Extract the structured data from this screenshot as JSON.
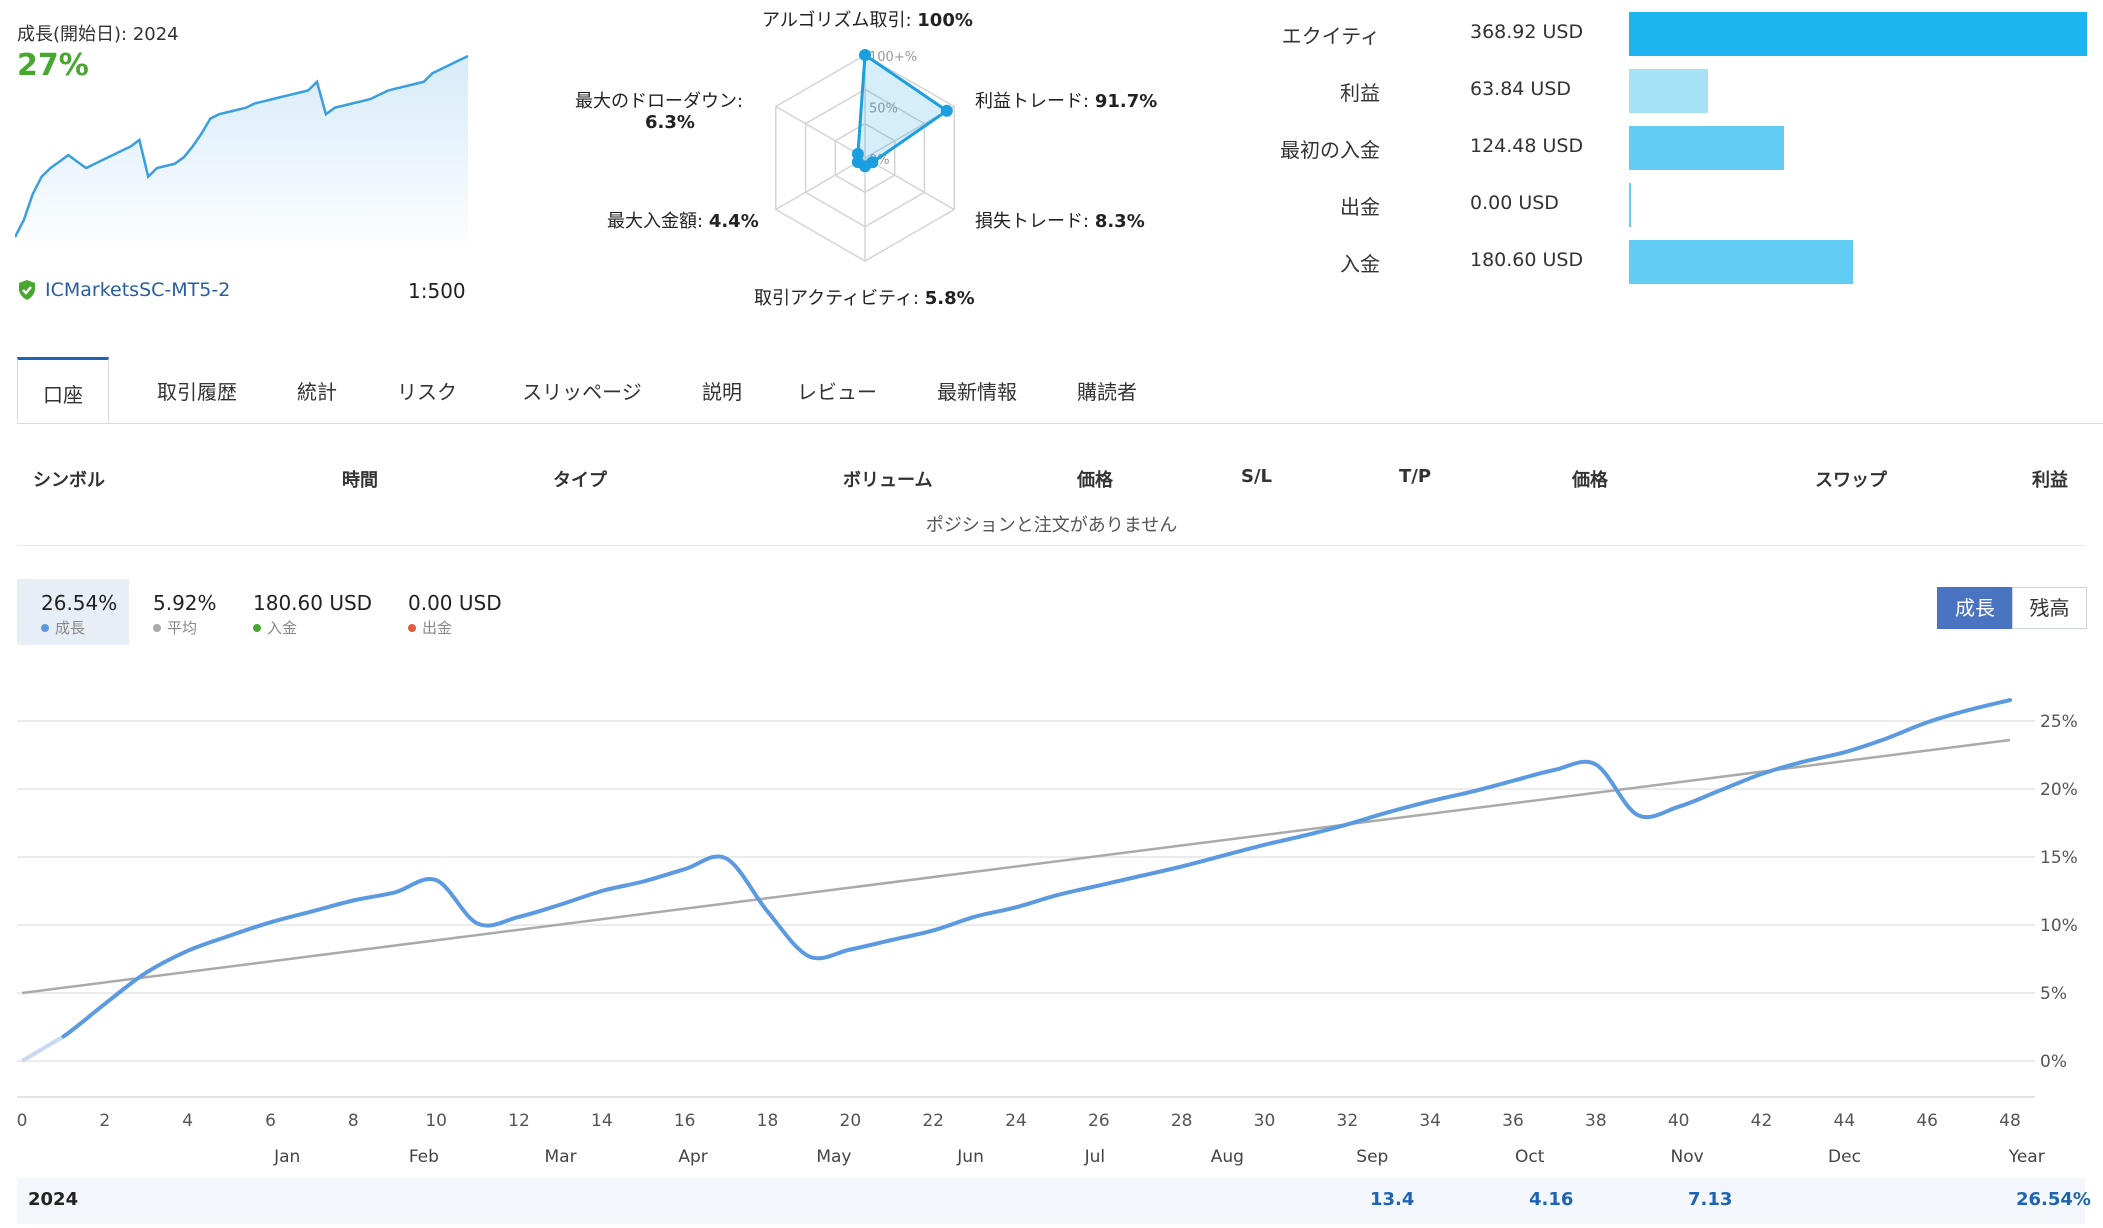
{
  "account": {
    "growth_label": "成長(開始日): 2024",
    "growth_value": "27%",
    "broker": "ICMarketsSC-MT5-2",
    "leverage": "1:500"
  },
  "radar": {
    "labels": [
      {
        "name": "アルゴリズム取引:",
        "value": "100%"
      },
      {
        "name": "利益トレード:",
        "value": "91.7%"
      },
      {
        "name": "損失トレード:",
        "value": "8.3%"
      },
      {
        "name": "取引アクティビティ:",
        "value": "5.8%"
      },
      {
        "name": "最大入金額:",
        "value": "4.4%"
      },
      {
        "name": "最大のドローダウン:",
        "value": "6.3%"
      }
    ],
    "values": [
      100,
      91.7,
      8.3,
      5.8,
      4.4,
      6.3
    ],
    "scale_labels": [
      "100+%",
      "50%",
      "0%"
    ],
    "accent_color": "#1aa0e0"
  },
  "stats": [
    {
      "label": "エクイティ",
      "value": "368.92 USD",
      "amount": 368.92,
      "color": "#1eb4ef"
    },
    {
      "label": "利益",
      "value": "63.84 USD",
      "amount": 63.84,
      "color": "#a7e1f6"
    },
    {
      "label": "最初の入金",
      "value": "124.48 USD",
      "amount": 124.48,
      "color": "#62cdf4"
    },
    {
      "label": "出金",
      "value": "0.00 USD",
      "amount": 0.0,
      "color": "#62cdf4"
    },
    {
      "label": "入金",
      "value": "180.60 USD",
      "amount": 180.6,
      "color": "#62cdf4"
    }
  ],
  "tabs": [
    "口座",
    "取引履歴",
    "統計",
    "リスク",
    "スリッページ",
    "説明",
    "レビュー",
    "最新情報",
    "購読者"
  ],
  "table": {
    "headers": [
      "シンボル",
      "時間",
      "タイプ",
      "ボリューム",
      "価格",
      "S/L",
      "T/P",
      "価格",
      "スワップ",
      "利益"
    ],
    "empty_message": "ポジションと注文がありません"
  },
  "summary": [
    {
      "value": "26.54%",
      "label": "成長",
      "color": "#5b9ae0"
    },
    {
      "value": "5.92%",
      "label": "平均",
      "color": "#aaaaaa"
    },
    {
      "value": "180.60 USD",
      "label": "入金",
      "color": "#46a82f"
    },
    {
      "value": "0.00 USD",
      "label": "出金",
      "color": "#e05a3a"
    }
  ],
  "toggle": {
    "growth": "成長",
    "balance": "残高"
  },
  "mini_chart": {
    "values": [
      0,
      4,
      10,
      14,
      16,
      17.5,
      19,
      17.5,
      16,
      17,
      18,
      19,
      20,
      21,
      22.5,
      14,
      16,
      16.5,
      17,
      18.5,
      21,
      24,
      27.5,
      28.5,
      29,
      29.5,
      30,
      31,
      31.5,
      32,
      32.5,
      33,
      33.5,
      34,
      36,
      28.5,
      30,
      30.5,
      31,
      31.5,
      32,
      33,
      34,
      34.5,
      35,
      35.5,
      36,
      38,
      39,
      40,
      41,
      42
    ]
  },
  "chart_data": {
    "type": "line",
    "x": [
      0,
      1,
      2,
      3,
      4,
      5,
      6,
      7,
      8,
      9,
      10,
      11,
      12,
      13,
      14,
      15,
      16,
      17,
      18,
      19,
      20,
      21,
      22,
      23,
      24,
      25,
      26,
      27,
      28,
      29,
      30,
      31,
      32,
      33,
      34,
      35,
      36,
      37,
      38,
      39,
      40,
      41,
      42,
      43,
      44,
      45,
      46,
      47,
      48
    ],
    "series": [
      {
        "name": "成長",
        "color": "#5b9ae0",
        "values": [
          0,
          1.8,
          4.2,
          6.5,
          8.1,
          9.2,
          10.2,
          11.0,
          11.8,
          12.4,
          13.3,
          10.1,
          10.6,
          11.5,
          12.5,
          13.2,
          14.1,
          14.9,
          11.0,
          7.7,
          8.2,
          8.9,
          9.6,
          10.6,
          11.3,
          12.2,
          12.9,
          13.6,
          14.3,
          15.1,
          15.9,
          16.6,
          17.4,
          18.3,
          19.1,
          19.8,
          20.6,
          21.4,
          21.8,
          18.1,
          18.7,
          19.9,
          21.1,
          22.0,
          22.7,
          23.7,
          24.9,
          25.8,
          26.54
        ]
      },
      {
        "name": "平均",
        "color": "#aaaaaa",
        "trend": true,
        "values_endpoints": [
          5.0,
          23.6
        ]
      }
    ],
    "xlim": [
      0,
      48
    ],
    "ylim": [
      -2,
      28
    ],
    "yticks": [
      0,
      5,
      10,
      15,
      20,
      25
    ],
    "ytick_labels": [
      "0%",
      "5%",
      "10%",
      "15%",
      "20%",
      "25%"
    ],
    "xticks": [
      0,
      2,
      4,
      6,
      8,
      10,
      12,
      14,
      16,
      18,
      20,
      22,
      24,
      26,
      28,
      30,
      32,
      34,
      36,
      38,
      40,
      42,
      44,
      46,
      48
    ],
    "months": [
      {
        "label": "Jan",
        "x": 6.5
      },
      {
        "label": "Feb",
        "x": 9.8
      },
      {
        "label": "Mar",
        "x": 13.1
      },
      {
        "label": "Apr",
        "x": 16.3
      },
      {
        "label": "May",
        "x": 19.7
      },
      {
        "label": "Jun",
        "x": 23.0
      },
      {
        "label": "Jul",
        "x": 26.0
      },
      {
        "label": "Aug",
        "x": 29.2
      },
      {
        "label": "Sep",
        "x": 32.7
      },
      {
        "label": "Oct",
        "x": 36.5
      },
      {
        "label": "Nov",
        "x": 40.3
      },
      {
        "label": "Dec",
        "x": 44.1
      },
      {
        "label": "Year",
        "x": 48.5
      }
    ],
    "grid": true
  },
  "year_row": {
    "year": "2024",
    "cells": [
      {
        "month": "Sep",
        "value": "13.4"
      },
      {
        "month": "Oct",
        "value": "4.16"
      },
      {
        "month": "Nov",
        "value": "7.13"
      },
      {
        "month": "Year",
        "value": "26.54%"
      }
    ]
  }
}
